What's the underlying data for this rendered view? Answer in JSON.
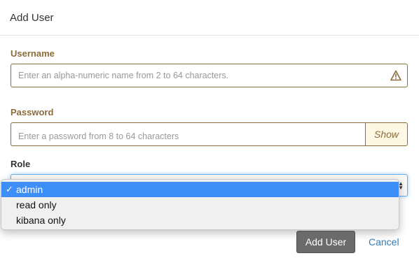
{
  "dialog": {
    "title": "Add User"
  },
  "form": {
    "username": {
      "label": "Username",
      "placeholder": "Enter an alpha-numeric name from 2 to 64 characters.",
      "status": "warning"
    },
    "password": {
      "label": "Password",
      "placeholder": "Enter a password from 8 to 64 characters",
      "show_label": "Show"
    },
    "role": {
      "label": "Role",
      "selected": "admin",
      "options": [
        {
          "label": "admin",
          "selected": true,
          "check": "✓"
        },
        {
          "label": "read only",
          "selected": false
        },
        {
          "label": "kibana only",
          "selected": false
        }
      ]
    }
  },
  "footer": {
    "submit_label": "Add User",
    "cancel_label": "Cancel"
  },
  "colors": {
    "warning": "#8a6d3b",
    "addon_bg": "#fcf8e3",
    "selected_option": "#3d8ff7",
    "link": "#337ab7",
    "submit_bg": "#6b6b6b"
  }
}
